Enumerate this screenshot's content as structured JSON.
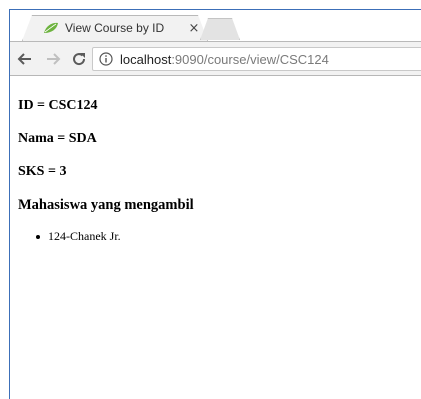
{
  "browser": {
    "tab_title": "View Course by ID",
    "tab_close": "×",
    "url_host": "localhost",
    "url_path": ":9090/course/view/CSC124",
    "icons": {
      "back": "arrow-left-icon",
      "forward": "arrow-right-icon",
      "reload": "reload-icon",
      "info": "info-icon",
      "favicon": "leaf-icon"
    },
    "accent": "#3c6fb8"
  },
  "page": {
    "id_line": "ID = CSC124",
    "nama_line": "Nama = SDA",
    "sks_line": "SKS = 3",
    "students_heading": "Mahasiswa yang mengambil",
    "students": [
      {
        "label": "124-Chanek Jr."
      }
    ]
  }
}
